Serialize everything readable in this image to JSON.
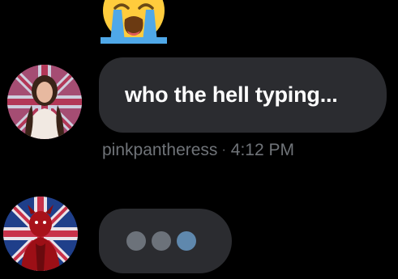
{
  "reaction": {
    "emoji_icon": "loudly-crying-face-icon"
  },
  "messages": [
    {
      "avatar_icon": "user-avatar-pinkpantheress",
      "text": "who the hell typing...",
      "sender": "pinkpantheress",
      "separator": "·",
      "time": "4:12 PM"
    }
  ],
  "typing_indicator": {
    "avatar_icon": "user-avatar-red-devil",
    "dot_colors": [
      "#6c727a",
      "#6c727a",
      "#5f88ad"
    ]
  },
  "colors": {
    "background": "#000000",
    "bubble": "#2b2c30",
    "meta_text": "#6f7378",
    "message_text": "#ffffff"
  }
}
